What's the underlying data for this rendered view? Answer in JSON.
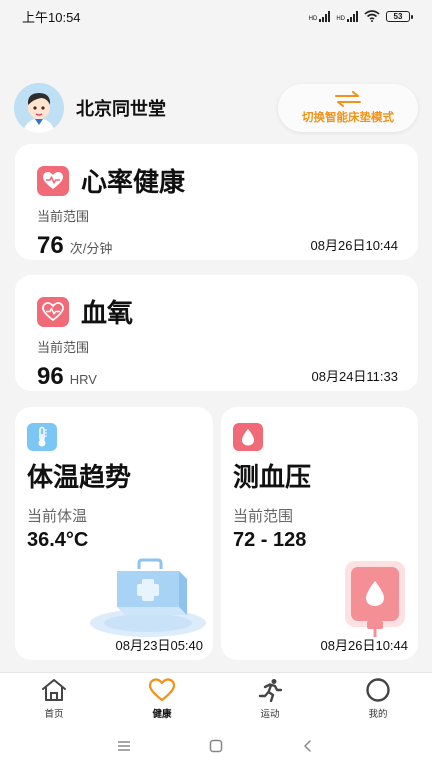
{
  "status_bar": {
    "time": "上午10:54",
    "battery": "53",
    "net1": "HD",
    "net2": "HD"
  },
  "header": {
    "brand": "北京同世堂",
    "switch_mode_label": "切换智能床垫模式"
  },
  "cards": {
    "heart_rate": {
      "title": "心率健康",
      "range_label": "当前范围",
      "value": "76",
      "unit": "次/分钟",
      "timestamp": "08月26日10:44"
    },
    "blood_oxygen": {
      "title": "血氧",
      "range_label": "当前范围",
      "value": "96",
      "unit": "HRV",
      "timestamp": "08月24日11:33"
    },
    "temperature": {
      "title": "体温趋势",
      "range_label": "当前体温",
      "value": "36.4°C",
      "timestamp": "08月23日05:40"
    },
    "blood_pressure": {
      "title": "测血压",
      "range_label": "当前范围",
      "value": "72 - 128",
      "timestamp": "08月26日10:44"
    }
  },
  "tab_bar": {
    "items": [
      {
        "label": "首页",
        "icon": "home-icon"
      },
      {
        "label": "健康",
        "icon": "heart-icon"
      },
      {
        "label": "运动",
        "icon": "running-icon"
      },
      {
        "label": "我的",
        "icon": "circle-icon"
      }
    ],
    "active": "健康"
  },
  "colors": {
    "accent_orange": "#f0931a",
    "heart_red": "#f06a77",
    "thermo_blue": "#7bc6f4",
    "background": "#f4f4f4"
  }
}
